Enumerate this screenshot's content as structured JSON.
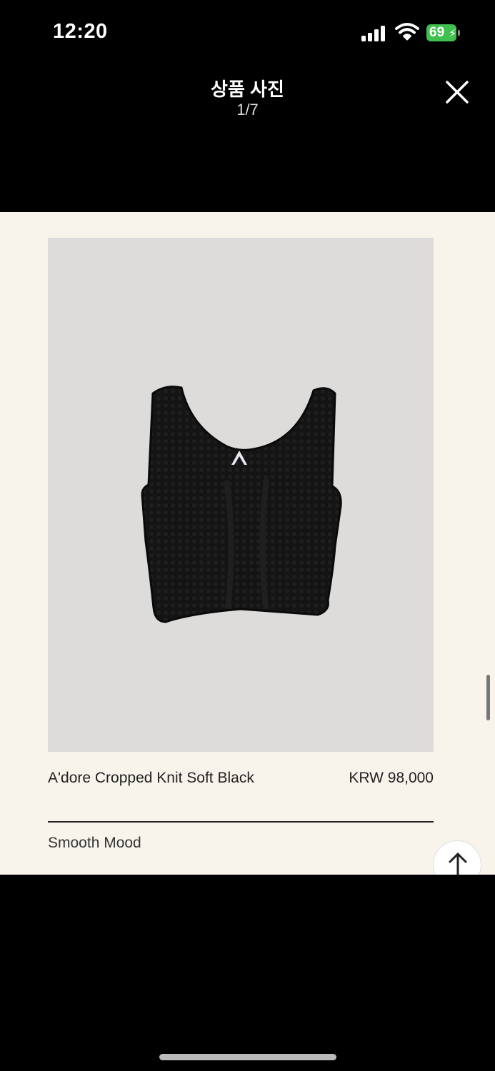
{
  "status_bar": {
    "time": "12:20",
    "battery": "69"
  },
  "header": {
    "title": "상품 사진",
    "counter": "1/7"
  },
  "product": {
    "name": "A'dore Cropped Knit Soft Black",
    "price": "KRW 98,000",
    "brand": "Smooth Mood"
  },
  "colors": {
    "background": "#000000",
    "content_bg": "#f8f4ec",
    "battery": "#3fc04f"
  }
}
